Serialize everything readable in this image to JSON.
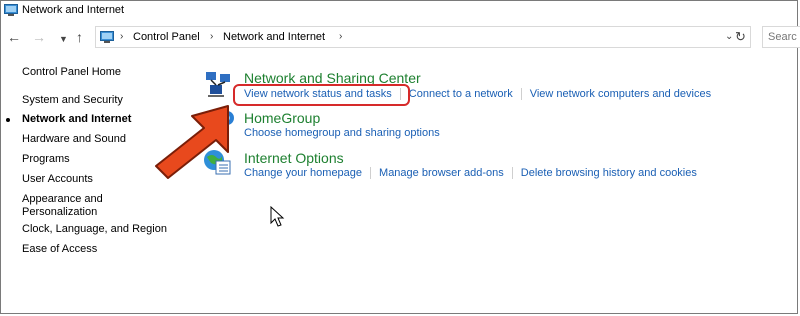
{
  "window": {
    "title": "Network and Internet",
    "icon": "control-panel-icon"
  },
  "nav": {
    "back_icon": "back-arrow-icon",
    "forward_icon": "forward-arrow-icon",
    "recent_icon": "recent-locations-chevron-icon",
    "up_icon": "up-arrow-icon"
  },
  "address": {
    "crumbs": [
      "Control Panel",
      "Network and Internet"
    ],
    "dropdown_icon": "chevron-down-icon",
    "refresh_icon": "refresh-icon"
  },
  "search": {
    "placeholder": "Searc"
  },
  "sidebar": {
    "home": "Control Panel Home",
    "items": [
      {
        "label": "System and Security",
        "current": false
      },
      {
        "label": "Network and Internet",
        "current": true
      },
      {
        "label": "Hardware and Sound",
        "current": false
      },
      {
        "label": "Programs",
        "current": false
      },
      {
        "label": "User Accounts",
        "current": false
      },
      {
        "label": "Appearance and",
        "current": false
      },
      {
        "label": "Personalization",
        "current": false
      },
      {
        "label": "Clock, Language, and Region",
        "current": false
      },
      {
        "label": "Ease of Access",
        "current": false
      }
    ]
  },
  "categories": [
    {
      "title": "Network and Sharing Center",
      "icon": "network-sharing-center-icon",
      "links": [
        "View network status and tasks",
        "Connect to a network",
        "View network computers and devices"
      ]
    },
    {
      "title": "HomeGroup",
      "icon": "homegroup-icon",
      "links": [
        "Choose homegroup and sharing options"
      ]
    },
    {
      "title": "Internet Options",
      "icon": "internet-options-icon",
      "links": [
        "Change your homepage",
        "Manage browser add-ons",
        "Delete browsing history and cookies"
      ]
    }
  ],
  "annotation": {
    "highlight_color": "#d62a2a",
    "arrow_color": "#e8491d"
  },
  "colors": {
    "category_title": "#1e8030",
    "link": "#1a5fb4"
  }
}
